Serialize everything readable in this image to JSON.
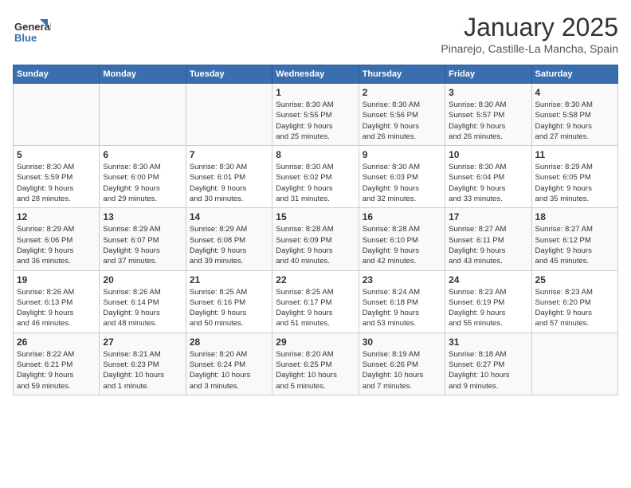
{
  "logo": {
    "line1": "General",
    "line2": "Blue"
  },
  "title": "January 2025",
  "subtitle": "Pinarejo, Castille-La Mancha, Spain",
  "days_of_week": [
    "Sunday",
    "Monday",
    "Tuesday",
    "Wednesday",
    "Thursday",
    "Friday",
    "Saturday"
  ],
  "weeks": [
    [
      {
        "day": "",
        "detail": ""
      },
      {
        "day": "",
        "detail": ""
      },
      {
        "day": "",
        "detail": ""
      },
      {
        "day": "1",
        "detail": "Sunrise: 8:30 AM\nSunset: 5:55 PM\nDaylight: 9 hours\nand 25 minutes."
      },
      {
        "day": "2",
        "detail": "Sunrise: 8:30 AM\nSunset: 5:56 PM\nDaylight: 9 hours\nand 26 minutes."
      },
      {
        "day": "3",
        "detail": "Sunrise: 8:30 AM\nSunset: 5:57 PM\nDaylight: 9 hours\nand 26 minutes."
      },
      {
        "day": "4",
        "detail": "Sunrise: 8:30 AM\nSunset: 5:58 PM\nDaylight: 9 hours\nand 27 minutes."
      }
    ],
    [
      {
        "day": "5",
        "detail": "Sunrise: 8:30 AM\nSunset: 5:59 PM\nDaylight: 9 hours\nand 28 minutes."
      },
      {
        "day": "6",
        "detail": "Sunrise: 8:30 AM\nSunset: 6:00 PM\nDaylight: 9 hours\nand 29 minutes."
      },
      {
        "day": "7",
        "detail": "Sunrise: 8:30 AM\nSunset: 6:01 PM\nDaylight: 9 hours\nand 30 minutes."
      },
      {
        "day": "8",
        "detail": "Sunrise: 8:30 AM\nSunset: 6:02 PM\nDaylight: 9 hours\nand 31 minutes."
      },
      {
        "day": "9",
        "detail": "Sunrise: 8:30 AM\nSunset: 6:03 PM\nDaylight: 9 hours\nand 32 minutes."
      },
      {
        "day": "10",
        "detail": "Sunrise: 8:30 AM\nSunset: 6:04 PM\nDaylight: 9 hours\nand 33 minutes."
      },
      {
        "day": "11",
        "detail": "Sunrise: 8:29 AM\nSunset: 6:05 PM\nDaylight: 9 hours\nand 35 minutes."
      }
    ],
    [
      {
        "day": "12",
        "detail": "Sunrise: 8:29 AM\nSunset: 6:06 PM\nDaylight: 9 hours\nand 36 minutes."
      },
      {
        "day": "13",
        "detail": "Sunrise: 8:29 AM\nSunset: 6:07 PM\nDaylight: 9 hours\nand 37 minutes."
      },
      {
        "day": "14",
        "detail": "Sunrise: 8:29 AM\nSunset: 6:08 PM\nDaylight: 9 hours\nand 39 minutes."
      },
      {
        "day": "15",
        "detail": "Sunrise: 8:28 AM\nSunset: 6:09 PM\nDaylight: 9 hours\nand 40 minutes."
      },
      {
        "day": "16",
        "detail": "Sunrise: 8:28 AM\nSunset: 6:10 PM\nDaylight: 9 hours\nand 42 minutes."
      },
      {
        "day": "17",
        "detail": "Sunrise: 8:27 AM\nSunset: 6:11 PM\nDaylight: 9 hours\nand 43 minutes."
      },
      {
        "day": "18",
        "detail": "Sunrise: 8:27 AM\nSunset: 6:12 PM\nDaylight: 9 hours\nand 45 minutes."
      }
    ],
    [
      {
        "day": "19",
        "detail": "Sunrise: 8:26 AM\nSunset: 6:13 PM\nDaylight: 9 hours\nand 46 minutes."
      },
      {
        "day": "20",
        "detail": "Sunrise: 8:26 AM\nSunset: 6:14 PM\nDaylight: 9 hours\nand 48 minutes."
      },
      {
        "day": "21",
        "detail": "Sunrise: 8:25 AM\nSunset: 6:16 PM\nDaylight: 9 hours\nand 50 minutes."
      },
      {
        "day": "22",
        "detail": "Sunrise: 8:25 AM\nSunset: 6:17 PM\nDaylight: 9 hours\nand 51 minutes."
      },
      {
        "day": "23",
        "detail": "Sunrise: 8:24 AM\nSunset: 6:18 PM\nDaylight: 9 hours\nand 53 minutes."
      },
      {
        "day": "24",
        "detail": "Sunrise: 8:23 AM\nSunset: 6:19 PM\nDaylight: 9 hours\nand 55 minutes."
      },
      {
        "day": "25",
        "detail": "Sunrise: 8:23 AM\nSunset: 6:20 PM\nDaylight: 9 hours\nand 57 minutes."
      }
    ],
    [
      {
        "day": "26",
        "detail": "Sunrise: 8:22 AM\nSunset: 6:21 PM\nDaylight: 9 hours\nand 59 minutes."
      },
      {
        "day": "27",
        "detail": "Sunrise: 8:21 AM\nSunset: 6:23 PM\nDaylight: 10 hours\nand 1 minute."
      },
      {
        "day": "28",
        "detail": "Sunrise: 8:20 AM\nSunset: 6:24 PM\nDaylight: 10 hours\nand 3 minutes."
      },
      {
        "day": "29",
        "detail": "Sunrise: 8:20 AM\nSunset: 6:25 PM\nDaylight: 10 hours\nand 5 minutes."
      },
      {
        "day": "30",
        "detail": "Sunrise: 8:19 AM\nSunset: 6:26 PM\nDaylight: 10 hours\nand 7 minutes."
      },
      {
        "day": "31",
        "detail": "Sunrise: 8:18 AM\nSunset: 6:27 PM\nDaylight: 10 hours\nand 9 minutes."
      },
      {
        "day": "",
        "detail": ""
      }
    ]
  ]
}
